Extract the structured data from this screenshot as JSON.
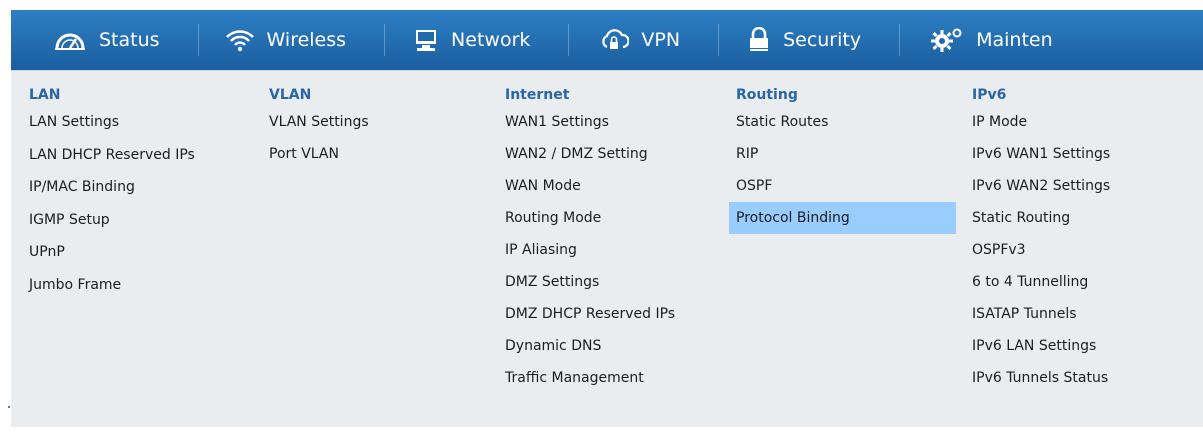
{
  "nav": {
    "status": "Status",
    "wireless": "Wireless",
    "network": "Network",
    "vpn": "VPN",
    "security": "Security",
    "maintenance": "Mainten"
  },
  "menu": {
    "lan": {
      "header": "LAN",
      "items": [
        "LAN Settings",
        "LAN DHCP Reserved IPs",
        "IP/MAC Binding",
        "IGMP Setup",
        "UPnP",
        "Jumbo Frame"
      ]
    },
    "vlan": {
      "header": "VLAN",
      "items": [
        "VLAN Settings",
        "Port VLAN"
      ]
    },
    "internet": {
      "header": "Internet",
      "items": [
        "WAN1 Settings",
        "WAN2 / DMZ Setting",
        "WAN Mode",
        "Routing Mode",
        "IP Aliasing",
        "DMZ Settings",
        "DMZ DHCP Reserved IPs",
        "Dynamic DNS",
        "Traffic Management"
      ]
    },
    "routing": {
      "header": "Routing",
      "items": [
        "Static Routes",
        "RIP",
        "OSPF",
        "Protocol Binding"
      ]
    },
    "ipv6": {
      "header": "IPv6",
      "items": [
        "IP Mode",
        "IPv6 WAN1 Settings",
        "IPv6 WAN2 Settings",
        "Static Routing",
        "OSPFv3",
        "6 to 4 Tunnelling",
        "ISATAP Tunnels",
        "IPv6 LAN Settings",
        "IPv6 Tunnels Status"
      ]
    }
  },
  "colors": {
    "nav_bg": "#1f69ad",
    "panel_bg": "#e9edf0",
    "header_text": "#2a65a6",
    "highlight": "#99ccff"
  }
}
